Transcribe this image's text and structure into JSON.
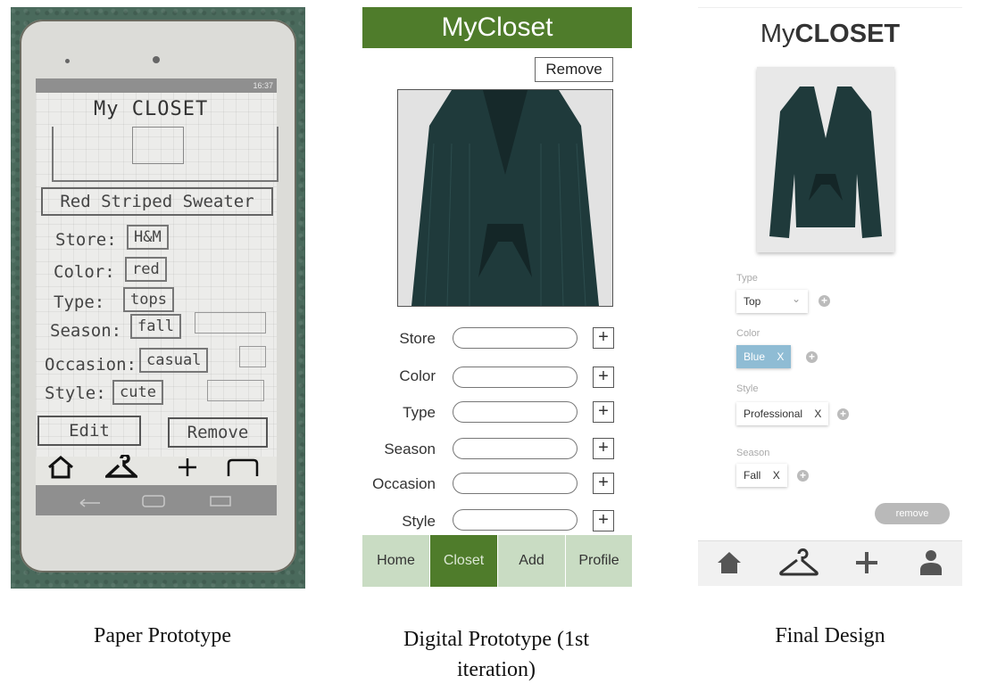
{
  "paper": {
    "status_time": "16:37",
    "title": "My CLOSET",
    "item_name": "Red Striped Sweater",
    "fields": [
      {
        "label": "Store:",
        "value": "H&M"
      },
      {
        "label": "Color:",
        "value": "red"
      },
      {
        "label": "Type:",
        "value": "tops"
      },
      {
        "label": "Season:",
        "value": "fall"
      },
      {
        "label": "Occasion:",
        "value": "casual"
      },
      {
        "label": "Style:",
        "value": "cute"
      }
    ],
    "edit_label": "Edit",
    "remove_label": "Remove",
    "caption": "Paper Prototype"
  },
  "digital": {
    "title": "MyCloset",
    "remove_label": "Remove",
    "fields": [
      "Store",
      "Color",
      "Type",
      "Season",
      "Occasion",
      "Style"
    ],
    "plus": "+",
    "tabs": [
      "Home",
      "Closet",
      "Add",
      "Profile"
    ],
    "active_tab": "Closet",
    "caption_line1": "Digital Prototype (1st",
    "caption_line2": "iteration)"
  },
  "final": {
    "title_prefix": "My",
    "title_bold": "CLOSET",
    "type_label": "Type",
    "type_value": "Top",
    "color_label": "Color",
    "color_value": "Blue",
    "style_label": "Style",
    "style_value": "Professional",
    "season_label": "Season",
    "season_value": "Fall",
    "chip_x": "X",
    "chevron": "⌄",
    "add": "+",
    "remove_label": "remove",
    "caption": "Final Design"
  },
  "colors": {
    "digital_green": "#4f7c2b",
    "digital_tab_bg": "#c9dcc3",
    "final_chip_blue": "#8fbcd4"
  }
}
